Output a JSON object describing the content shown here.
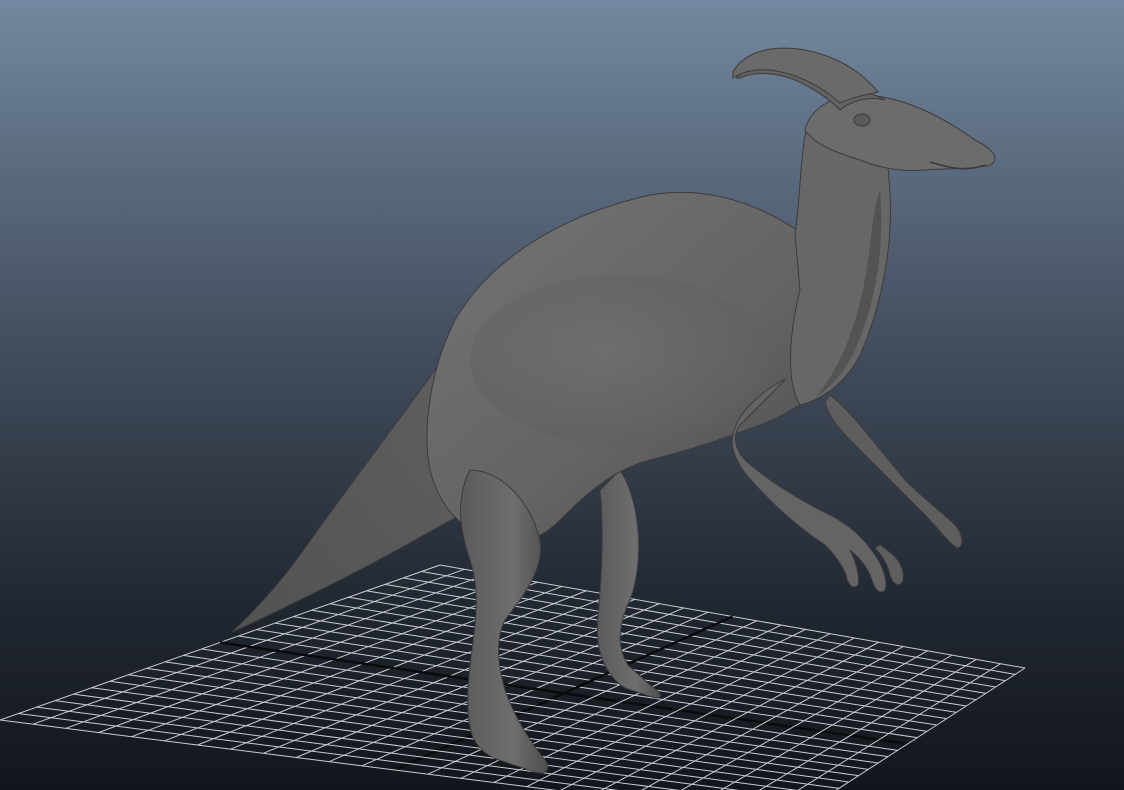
{
  "viewport": {
    "background_top": "#7388a0",
    "background_bottom": "#12161c",
    "grid_color": "#c9cdd2",
    "axis_color": "#0a0a0a",
    "model_base_color": "#686868",
    "model_shadow_color": "#3a3a3a"
  },
  "scene": {
    "model": "parasaurolophus-3d-model",
    "grid": "ground-grid",
    "shading": "smooth-shaded"
  }
}
